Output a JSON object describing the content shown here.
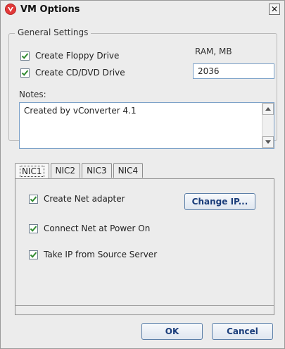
{
  "window": {
    "title": "VM Options",
    "close_glyph": "✕"
  },
  "general": {
    "legend": "General Settings",
    "create_floppy": {
      "label": "Create Floppy Drive",
      "checked": true
    },
    "create_cd": {
      "label": "Create CD/DVD Drive",
      "checked": true
    },
    "ram_label": "RAM, MB",
    "ram_value": "2036",
    "notes_label": "Notes:",
    "notes_value": "Created by vConverter 4.1"
  },
  "tabs": [
    {
      "label": "NIC1",
      "active": true
    },
    {
      "label": "NIC2",
      "active": false
    },
    {
      "label": "NIC3",
      "active": false
    },
    {
      "label": "NIC4",
      "active": false
    }
  ],
  "nic": {
    "create_adapter": {
      "label": "Create Net adapter",
      "checked": true
    },
    "connect_power_on": {
      "label": "Connect Net at Power On",
      "checked": true
    },
    "take_ip": {
      "label": "Take IP from Source Server",
      "checked": true
    },
    "change_ip_label": "Change IP..."
  },
  "footer": {
    "ok_label": "OK",
    "cancel_label": "Cancel"
  },
  "colors": {
    "check": "#2f8a2f",
    "button_text": "#1a3d7a",
    "title_icon": "#e23a3a"
  }
}
